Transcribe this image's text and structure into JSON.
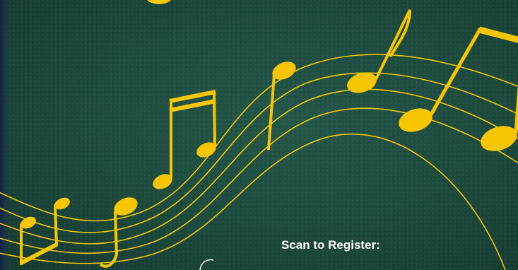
{
  "poster": {
    "cta_text": "Scan to Register:"
  },
  "colors": {
    "background": "#1d4a3c",
    "accent": "#f7c600",
    "text": "#ffffff"
  },
  "icons": {
    "decoration": "music-staff-icon",
    "qr_code": "qr-code-icon"
  }
}
